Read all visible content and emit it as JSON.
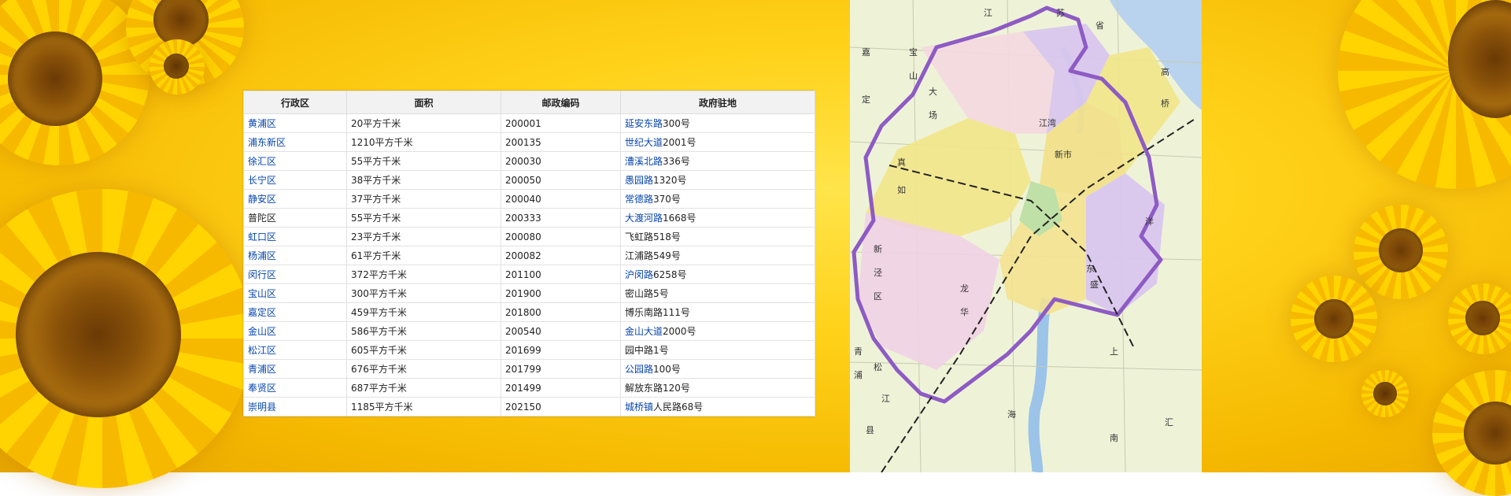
{
  "table": {
    "headers": [
      "行政区",
      "面积",
      "邮政编码",
      "政府驻地"
    ],
    "rows": [
      {
        "district": "黄浦区",
        "area": "20平方千米",
        "postcode": "200001",
        "seat_link": "延安东路",
        "seat_rest": "300号"
      },
      {
        "district": "浦东新区",
        "area": "1210平方千米",
        "postcode": "200135",
        "seat_link": "世纪大道",
        "seat_rest": "2001号"
      },
      {
        "district": "徐汇区",
        "area": "55平方千米",
        "postcode": "200030",
        "seat_link": "漕溪北路",
        "seat_rest": "336号"
      },
      {
        "district": "长宁区",
        "area": "38平方千米",
        "postcode": "200050",
        "seat_link": "愚园路",
        "seat_rest": "1320号"
      },
      {
        "district": "静安区",
        "area": "37平方千米",
        "postcode": "200040",
        "seat_link": "常德路",
        "seat_rest": "370号"
      },
      {
        "district": "普陀区",
        "area": "55平方千米",
        "postcode": "200333",
        "seat_link": "大渡河路",
        "seat_rest": "1668号",
        "district_plain": true
      },
      {
        "district": "虹口区",
        "area": "23平方千米",
        "postcode": "200080",
        "seat_link": "",
        "seat_rest": "飞虹路518号"
      },
      {
        "district": "杨浦区",
        "area": "61平方千米",
        "postcode": "200082",
        "seat_link": "",
        "seat_rest": "江浦路549号"
      },
      {
        "district": "闵行区",
        "area": "372平方千米",
        "postcode": "201100",
        "seat_link": "沪闵路",
        "seat_rest": "6258号"
      },
      {
        "district": "宝山区",
        "area": "300平方千米",
        "postcode": "201900",
        "seat_link": "",
        "seat_rest": "密山路5号"
      },
      {
        "district": "嘉定区",
        "area": "459平方千米",
        "postcode": "201800",
        "seat_link": "",
        "seat_rest": "博乐南路111号"
      },
      {
        "district": "金山区",
        "area": "586平方千米",
        "postcode": "200540",
        "seat_link": "金山大道",
        "seat_rest": "2000号"
      },
      {
        "district": "松江区",
        "area": "605平方千米",
        "postcode": "201699",
        "seat_link": "",
        "seat_rest": "园中路1号"
      },
      {
        "district": "青浦区",
        "area": "676平方千米",
        "postcode": "201799",
        "seat_link": "公园路",
        "seat_rest": "100号"
      },
      {
        "district": "奉贤区",
        "area": "687平方千米",
        "postcode": "201499",
        "seat_link": "",
        "seat_rest": "解放东路120号"
      },
      {
        "district": "崇明县",
        "area": "1185平方千米",
        "postcode": "202150",
        "seat_link": "城桥镇",
        "seat_rest": "人民路68号"
      }
    ]
  },
  "map_labels": [
    "江",
    "苏",
    "省",
    "宝",
    "山",
    "大",
    "场",
    "真",
    "如",
    "新",
    "泾",
    "区",
    "龙",
    "华",
    "高",
    "桥",
    "江湾",
    "新市",
    "洋",
    "上",
    "海",
    "南",
    "汇",
    "松",
    "江",
    "县",
    "嘉",
    "定",
    "青",
    "浦",
    "东",
    "盛"
  ],
  "colors": {
    "link": "#0645ad",
    "boundary": "#8e5bc4",
    "header_bg": "#f2f2f2"
  }
}
